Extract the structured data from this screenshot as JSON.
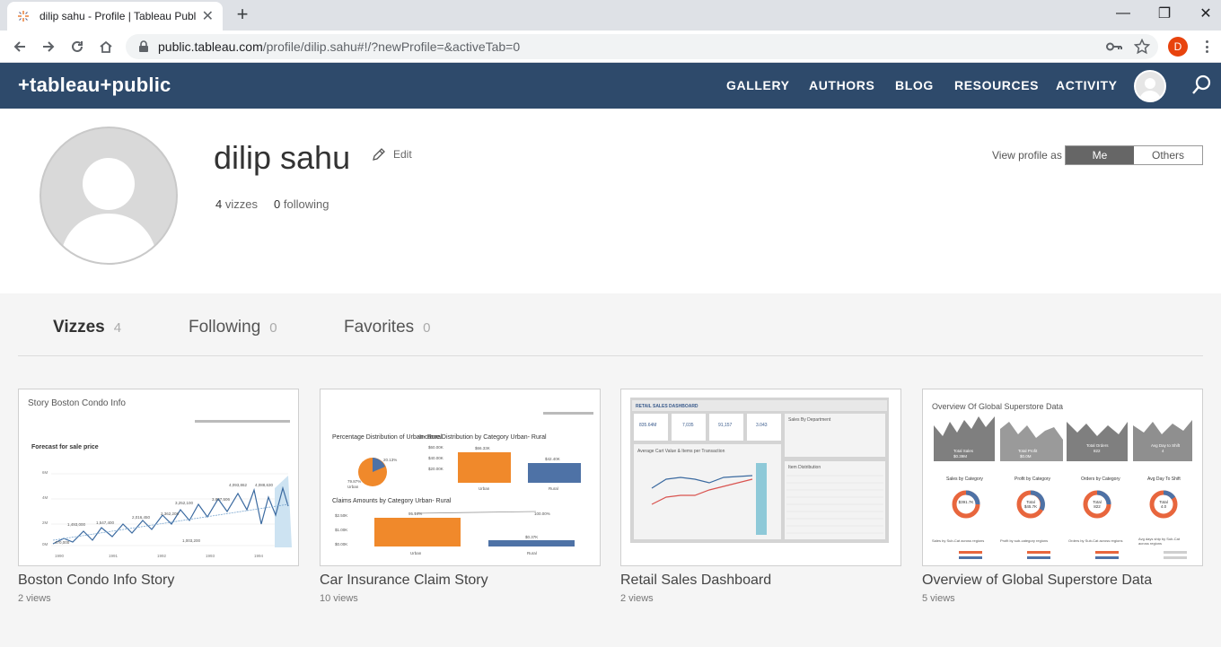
{
  "browser": {
    "tab_title": "dilip sahu - Profile | Tableau Publi",
    "url_host": "public.tableau.com",
    "url_rest": "/profile/dilip.sahu#!/?newProfile=&activeTab=0",
    "profile_initial": "D",
    "accent": "#e8430d"
  },
  "header": {
    "logo": "+tableau+public",
    "nav": [
      "GALLERY",
      "AUTHORS",
      "BLOG",
      "RESOURCES",
      "ACTIVITY"
    ],
    "bg_color": "#2e4a6b"
  },
  "profile": {
    "name": "dilip sahu",
    "edit_label": "Edit",
    "vizzes_count": "4",
    "vizzes_label": "vizzes",
    "following_count": "0",
    "following_label": "following",
    "view_as_label": "View profile as",
    "view_as_options": [
      "Me",
      "Others"
    ],
    "view_as_selected": "Me"
  },
  "tabs": [
    {
      "label": "Vizzes",
      "count": "4",
      "active": true
    },
    {
      "label": "Following",
      "count": "0",
      "active": false
    },
    {
      "label": "Favorites",
      "count": "0",
      "active": false
    }
  ],
  "vizzes": [
    {
      "title": "Boston Condo Info Story",
      "views": "2 views",
      "thumb_heading": "Story Boston Condo Info",
      "thumb_sub": "Forecast for sale price"
    },
    {
      "title": "Car Insurance Claim Story",
      "views": "10 views",
      "thumb_heading": "Percentage Distribution of Urban- Rural",
      "thumb_sub": "Income Distribution by Category Urban- Rural",
      "thumb_sub2": "Claims Amounts by Category Urban- Rural"
    },
    {
      "title": "Retail Sales Dashboard",
      "views": "2 views",
      "thumb_heading": "RETAIL SALES DASHBOARD",
      "thumb_sub": "Average Cart Value & Items per Transaction",
      "thumb_sub2": "Sales By Department",
      "thumb_sub3": "Item Distribution"
    },
    {
      "title": "Overview of Global Superstore Data",
      "views": "5 views",
      "thumb_heading": "Overview Of Global Superstore Data",
      "thumb_sub": "Sales by Category",
      "thumb_sub2": "Profit by Category",
      "thumb_sub3": "Orders by Category",
      "thumb_sub4": "Avg Day To Shift"
    }
  ]
}
